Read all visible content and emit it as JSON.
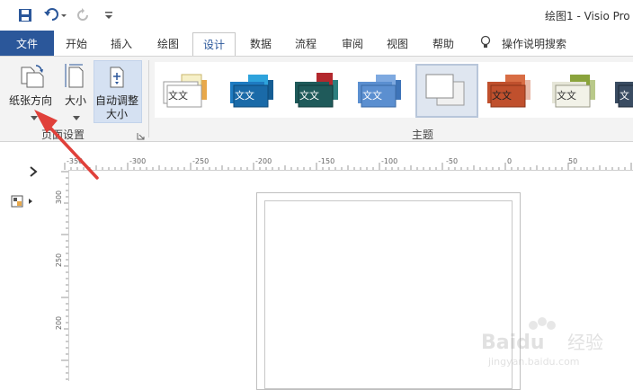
{
  "app": {
    "doc_title": "绘图1  -  Visio Pro"
  },
  "quick_access": {
    "save_icon": "save-icon",
    "undo_icon": "undo-icon",
    "redo_icon": "redo-icon",
    "customize_icon": "chevron-down-icon"
  },
  "tabs": [
    {
      "label": "文件"
    },
    {
      "label": "开始"
    },
    {
      "label": "插入"
    },
    {
      "label": "绘图"
    },
    {
      "label": "设计"
    },
    {
      "label": "数据"
    },
    {
      "label": "流程"
    },
    {
      "label": "审阅"
    },
    {
      "label": "视图"
    },
    {
      "label": "帮助"
    }
  ],
  "tell_me": {
    "label": "操作说明搜索"
  },
  "ribbon": {
    "page_setup": {
      "orientation_label": "纸张方向",
      "size_label": "大小",
      "autofit_line1": "自动调整",
      "autofit_line2": "大小",
      "group_label": "页面设置"
    },
    "themes": {
      "group_label": "主题",
      "items": [
        {
          "text": "文文",
          "colors": [
            "#f6f0c8",
            "#e8a84a",
            "#6fa0d8"
          ]
        },
        {
          "text": "文文",
          "colors": [
            "#1e7bc1",
            "#155d94",
            "#2ea3dc"
          ]
        },
        {
          "text": "文文",
          "colors": [
            "#1f5a5a",
            "#b3282d",
            "#2d7f7f"
          ]
        },
        {
          "text": "文文",
          "colors": [
            "#5b8fd0",
            "#3e74b8",
            "#7ea9e0"
          ]
        },
        {
          "text": "",
          "colors": [
            "#ffffff",
            "#f0f0f0",
            "#e6e6e6"
          ]
        },
        {
          "text": "文文",
          "colors": [
            "#c0502d",
            "#d86d44",
            "#e8b9a8"
          ]
        },
        {
          "text": "文文",
          "colors": [
            "#e6e6d8",
            "#8aa33c",
            "#b9c98a"
          ]
        },
        {
          "text": "文",
          "colors": [
            "#3a4c62",
            "#2d3b4e",
            "#50627a"
          ]
        }
      ]
    }
  },
  "rulers": {
    "top_ticks": [
      "-350",
      "-300",
      "-250",
      "-200",
      "-150",
      "-100",
      "-50",
      "0",
      "50"
    ],
    "left_ticks": [
      "300",
      "250",
      "200"
    ]
  },
  "watermark": {
    "brand": "Baidu",
    "suffix": "经验",
    "url": "jingyan.baidu.com"
  }
}
